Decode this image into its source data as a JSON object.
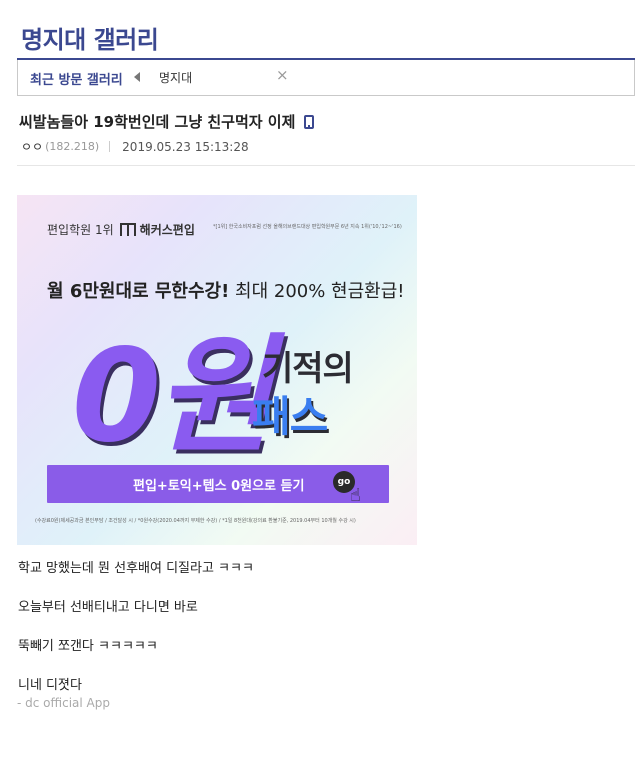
{
  "gallery": {
    "title": "명지대 갤러리"
  },
  "recent": {
    "label": "최근 방문 갤러리",
    "item": "명지대",
    "close": "×"
  },
  "post": {
    "title": "씨발놈들아 19학번인데 그냥 친구먹자 이제",
    "author": "ㅇㅇ",
    "ip": "(182.218)",
    "date": "2019.05.23 15:13:28"
  },
  "ad": {
    "top_rank": "편입학원 1위",
    "brand": "해커스편입",
    "small_note": "*[1위] 한국소비자포럼 선정 올해의브랜드대상 편입학원부문 6년 지속 1위('10,'12~'16)",
    "headline_bold": "월 6만원대로 무한수강!",
    "headline_rest": " 최대 200% 현금환급!",
    "big_zero": "0원",
    "word_top": "기적의",
    "word_bottom": "패스",
    "cta": "편입+토익+텝스 0원으로 듣기",
    "go": "go",
    "footnote": "(수강료0원)제세공과금 본인부담 / 조건달성 시 / *0원수강(2020.04까지 무제한 수강) / *1일 8천원대(강의료 환불기준, 2019.04부터 10개월 수강 시)"
  },
  "body": {
    "lines": [
      "학교 망했는데 뭔 선후배여 디질라고 ㅋㅋㅋ",
      "오늘부터 선배티내고 다니면 바로",
      "뚝빼기 쪼갠다 ㅋㅋㅋㅋㅋ",
      "니네 디졋다"
    ],
    "signature": "- dc official App"
  },
  "colors": {
    "accent": "#3b4890",
    "cta": "#8a5ce8"
  }
}
